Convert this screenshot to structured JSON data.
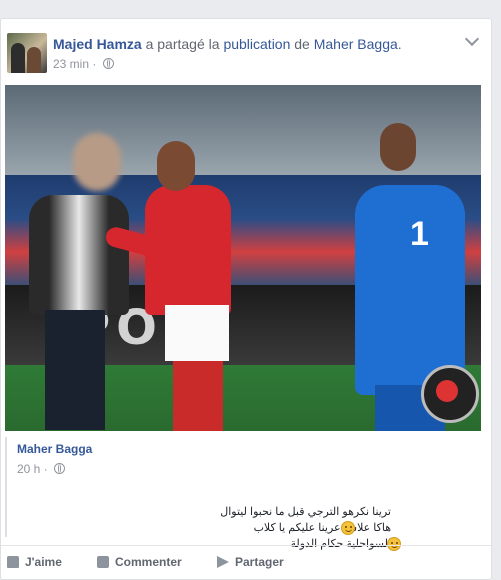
{
  "post": {
    "author": "Majed Hamza",
    "action_text": " a partagé la ",
    "object_link": "publication",
    "preposition": " de ",
    "original_author": "Maher Bagga",
    "end_punct": ".",
    "timestamp": "23 min",
    "separator": " · ",
    "privacy_icon": "globe-icon"
  },
  "shared": {
    "author": "Maher Bagga",
    "timestamp": "20 h",
    "separator": " · ",
    "lines": [
      "ترينا نكرهو الترجي قبل ما نحبوا ليتوال",
      "هاكا علاش عرينا عليكم يا كلاب",
      "السواحلية حكام الدولة"
    ]
  },
  "photo": {
    "keeper_number": "1",
    "adboard_text": "PO"
  },
  "actions": {
    "like": "J'aime",
    "comment": "Commenter",
    "share": "Partager"
  }
}
